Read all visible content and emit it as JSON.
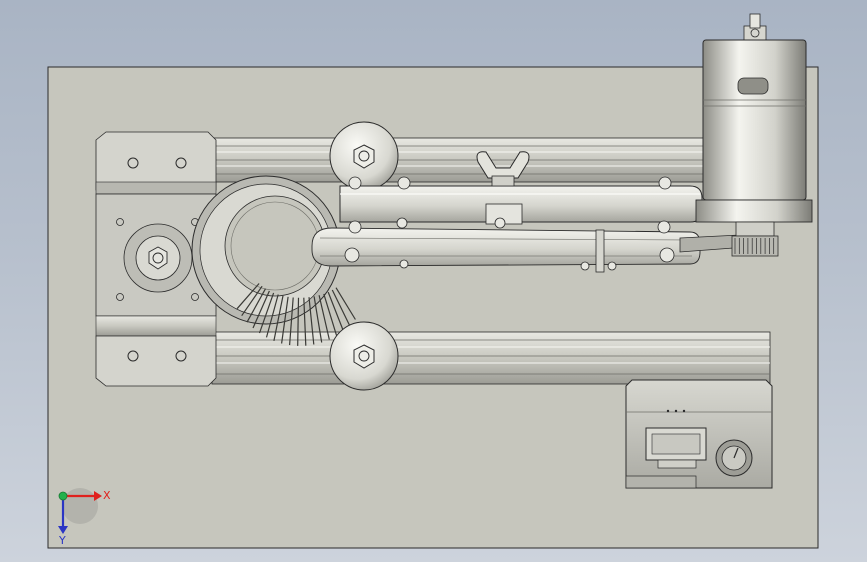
{
  "viewport": {
    "background_top": "#a9b4c4",
    "background_bottom": "#cdd3dc",
    "plate_color": "#c6c6bd",
    "metal_light": "#f2f2ee",
    "metal_dark": "#8e8e88",
    "edge_color": "#2b2b2b"
  },
  "triad": {
    "x_label": "X",
    "y_label": "Y",
    "x_color": "#e0211d",
    "y_color": "#2a35c4",
    "z_color": "#22b14c"
  },
  "model": {
    "parts": [
      "base-plate",
      "aluminum-extrusion-rail-top",
      "aluminum-extrusion-rail-bottom",
      "stepper-motor-mount",
      "coil-spring-guide",
      "idler-roller-top",
      "idler-roller-bottom",
      "belt-pulley-arm",
      "wing-nut",
      "dc-motor",
      "motor-controller-box"
    ]
  }
}
